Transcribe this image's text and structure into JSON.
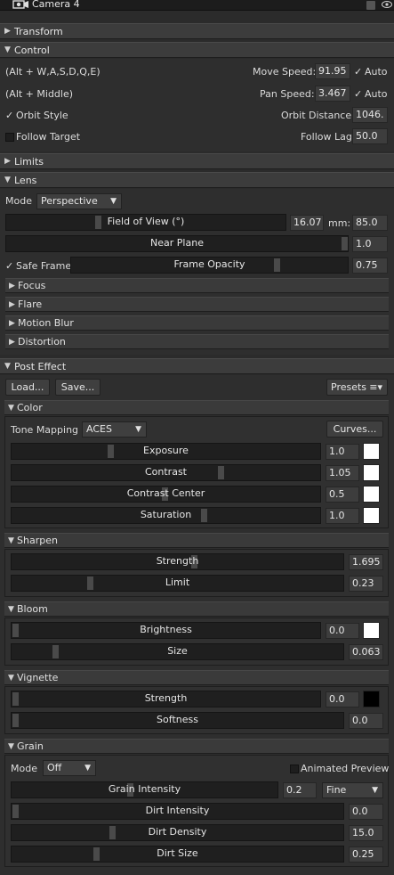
{
  "window": {
    "title": "Camera 4",
    "icons": [
      "camera-icon",
      "pin-icon",
      "eye-icon"
    ]
  },
  "sections": {
    "transform": {
      "label": "Transform"
    },
    "control": {
      "label": "Control",
      "move_keys": "(Alt + W,A,S,D,Q,E)",
      "pan_keys": "(Alt + Middle)",
      "orbit_style": "Orbit Style",
      "follow_target": "Follow Target",
      "move_speed_label": "Move Speed:",
      "move_speed": "91.95",
      "pan_speed_label": "Pan Speed:",
      "pan_speed": "3.467",
      "auto_label": "Auto",
      "orbit_distance_label": "Orbit Distance:",
      "orbit_distance": "1046.",
      "follow_lag_label": "Follow Lag",
      "follow_lag": "50.0",
      "check_mark": "✓"
    },
    "limits": {
      "label": "Limits"
    },
    "lens": {
      "label": "Lens",
      "mode_label": "Mode",
      "mode_value": "Perspective",
      "fov_label": "Field of View (°)",
      "fov": "16.07",
      "mm_label": "mm:",
      "mm": "85.0",
      "near_plane_label": "Near Plane",
      "near_plane": "1.0",
      "safe_frame": "Safe Frame",
      "frame_opacity_label": "Frame Opacity",
      "frame_opacity": "0.75",
      "subsections": [
        "Focus",
        "Flare",
        "Motion Blur",
        "Distortion"
      ]
    },
    "post_effect": {
      "label": "Post Effect",
      "load": "Load...",
      "save": "Save...",
      "presets": "Presets",
      "color": {
        "label": "Color",
        "tone_mapping_label": "Tone Mapping",
        "tone_mapping": "ACES",
        "curves": "Curves...",
        "exposure_label": "Exposure",
        "exposure": "1.0",
        "contrast_label": "Contrast",
        "contrast": "1.05",
        "contrast_center_label": "Contrast Center",
        "contrast_center": "0.5",
        "saturation_label": "Saturation",
        "saturation": "1.0"
      },
      "sharpen": {
        "label": "Sharpen",
        "strength_label": "Strength",
        "strength": "1.695",
        "limit_label": "Limit",
        "limit": "0.23"
      },
      "bloom": {
        "label": "Bloom",
        "brightness_label": "Brightness",
        "brightness": "0.0",
        "size_label": "Size",
        "size": "0.063"
      },
      "vignette": {
        "label": "Vignette",
        "strength_label": "Strength",
        "strength": "0.0",
        "softness_label": "Softness",
        "softness": "0.0"
      },
      "grain": {
        "label": "Grain",
        "mode_label": "Mode",
        "mode": "Off",
        "animated_preview": "Animated Preview",
        "intensity_label": "Grain Intensity",
        "intensity": "0.2",
        "quality": "Fine",
        "dirt_intensity_label": "Dirt Intensity",
        "dirt_intensity": "0.0",
        "dirt_density_label": "Dirt Density",
        "dirt_density": "15.0",
        "dirt_size_label": "Dirt Size",
        "dirt_size": "0.25"
      }
    }
  },
  "colors": {
    "swatch_white": "#ffffff",
    "swatch_black": "#000000",
    "background": "#2b2b2b"
  }
}
